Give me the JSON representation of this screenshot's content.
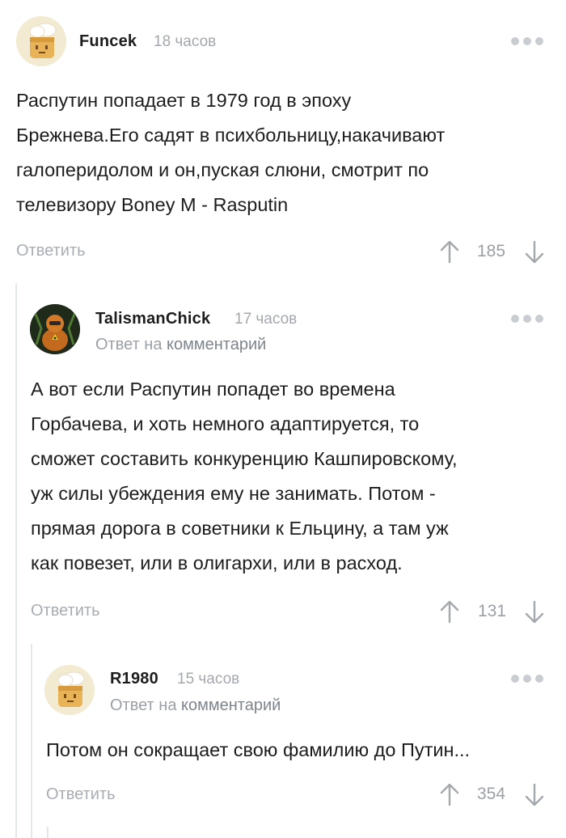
{
  "comments": [
    {
      "author": "Funcek",
      "time": "18 часов",
      "text_lines": [
        "Распутин попадает в 1979 год в эпоху",
        "Брежнева.Его садят в психбольницу,накачивают",
        "галоперидолом и он,пуская слюни, смотрит по",
        "телевизору Boney M - Rasputin"
      ],
      "reply_label": "Ответить",
      "rating": "185",
      "avatar_icon": "chef-hat-bread-avatar"
    },
    {
      "author": "TalismanChick",
      "time": "17 часов",
      "reply_to_prefix": "Ответ на",
      "reply_to_link": "комментарий",
      "text_lines": [
        "А вот если Распутин попадет во времена",
        "Горбачева, и хоть немного адаптируется, то",
        "сможет составить конкуренцию Кашпировскому,",
        "уж силы убеждения ему не занимать. Потом -",
        "прямая дорога в советники к Ельцину, а там уж",
        "как повезет, или в олигархи, или в расход."
      ],
      "reply_label": "Ответить",
      "rating": "131",
      "avatar_icon": "character-avatar"
    },
    {
      "author": "R1980",
      "time": "15 часов",
      "reply_to_prefix": "Ответ на",
      "reply_to_link": "комментарий",
      "text_lines": [
        "Потом он сокращает свою фамилию до Путин..."
      ],
      "reply_label": "Ответить",
      "rating": "354",
      "avatar_icon": "chef-hat-bread-avatar"
    }
  ],
  "colors": {
    "text": "#1d1d1d",
    "muted": "#a3a8ad",
    "thread_line": "#e3e6ea",
    "avatar_bg": "#f3ead2"
  }
}
